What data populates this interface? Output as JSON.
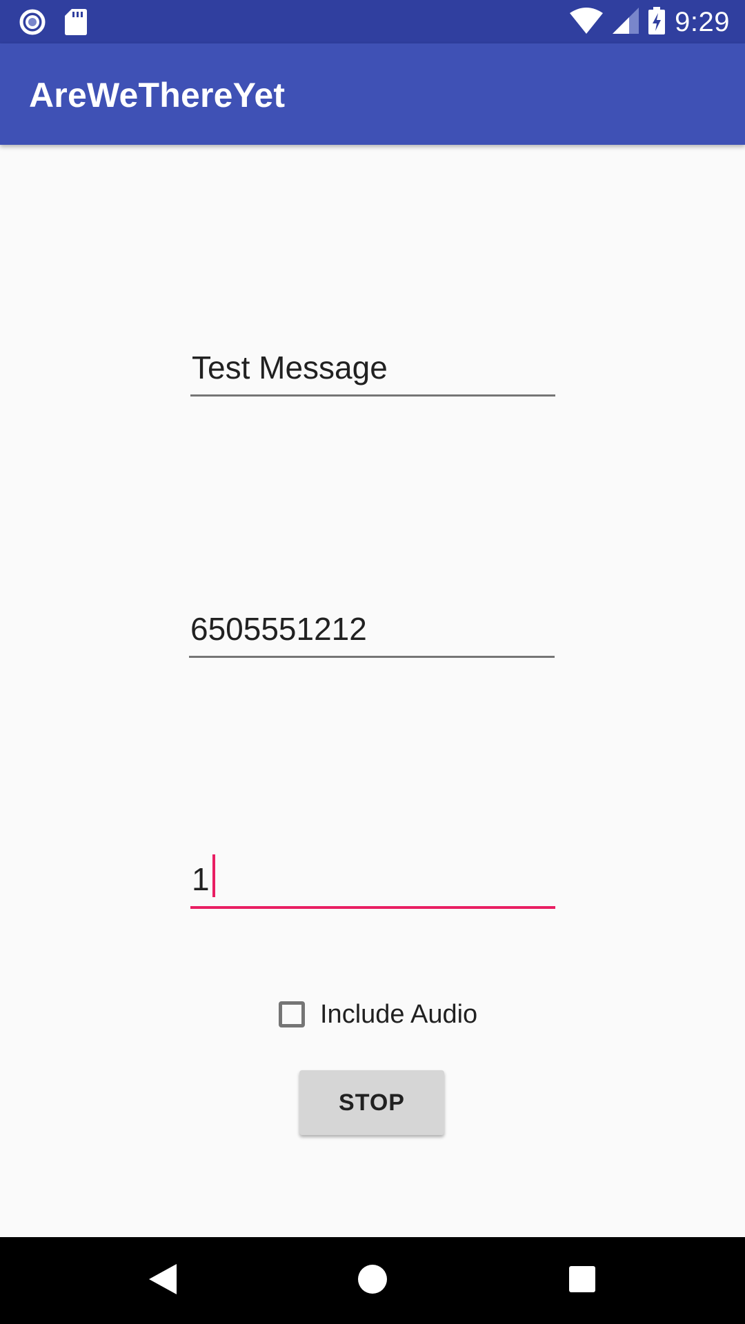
{
  "status_bar": {
    "time": "9:29",
    "icons": [
      "record-icon",
      "sd-card-icon",
      "wifi-icon",
      "cell-signal-icon",
      "battery-charging-icon"
    ]
  },
  "app_bar": {
    "title": "AreWeThereYet"
  },
  "form": {
    "message_value": "Test Message",
    "phone_value": "6505551212",
    "number_value": "1",
    "checkbox_label": "Include Audio",
    "checkbox_checked": false,
    "stop_label": "STOP"
  },
  "nav_bar": {
    "icons": [
      "back-icon",
      "home-icon",
      "recents-icon"
    ]
  },
  "colors": {
    "status_bar": "#303f9f",
    "app_bar": "#3f51b5",
    "accent": "#e91e63",
    "background": "#fafafa"
  }
}
